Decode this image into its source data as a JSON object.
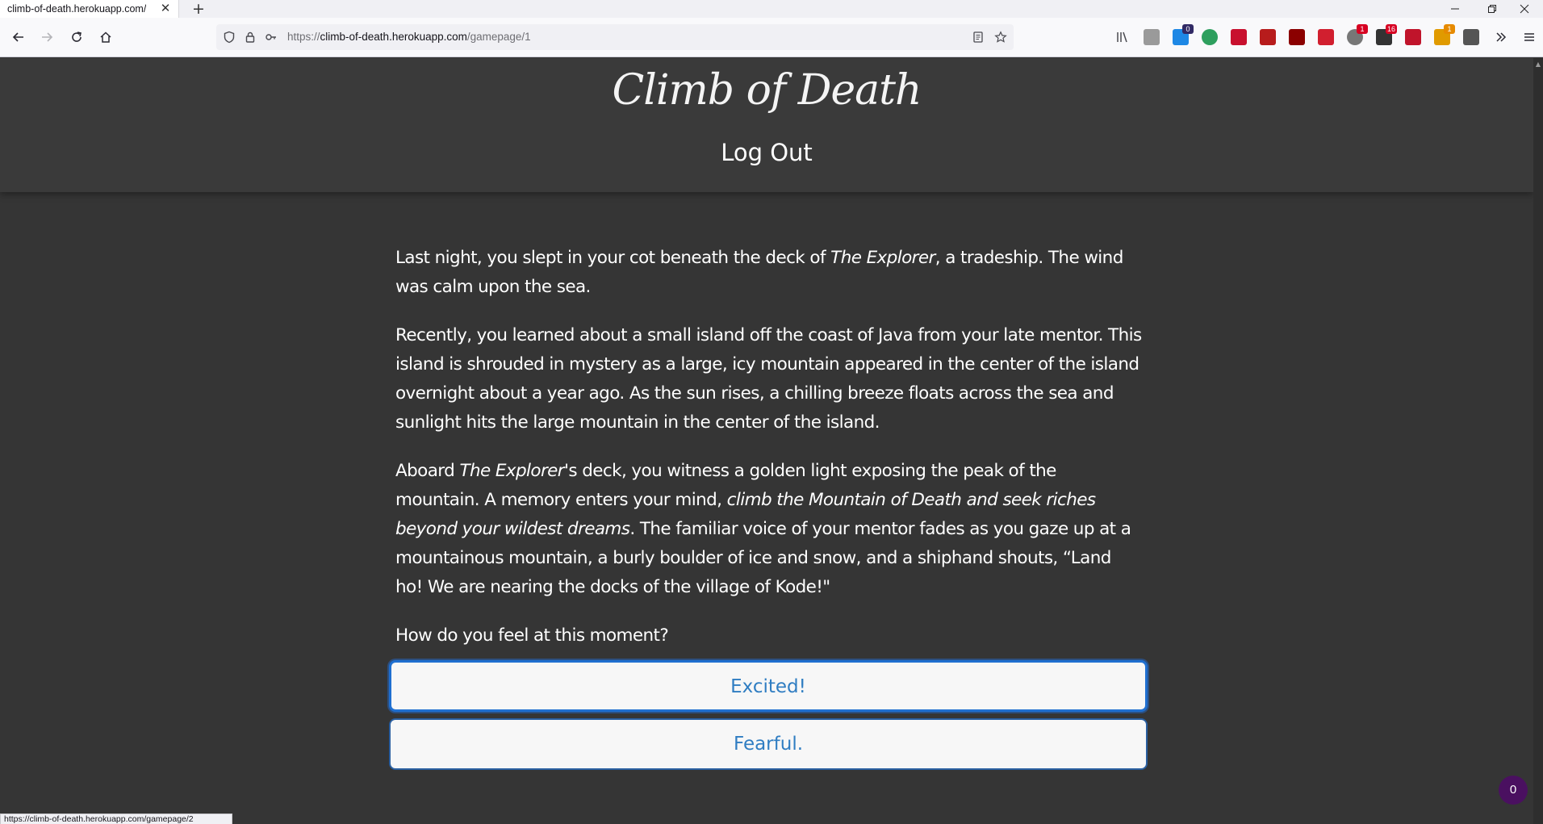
{
  "browser": {
    "tab_title": "climb-of-death.herokuapp.com/",
    "tab_close": "✕",
    "new_tab": "+",
    "url_prefix": "https://",
    "url_host": "climb-of-death.herokuapp.com",
    "url_path": "/gamepage/1",
    "status_link": "https://climb-of-death.herokuapp.com/gamepage/2",
    "extensions": [
      {
        "name": "library-icon",
        "color": "#4a4a50"
      },
      {
        "name": "extension-gray-icon",
        "color": "#9a9a9a"
      },
      {
        "name": "extension-blue-icon",
        "color": "#1e88e5",
        "badge": "0"
      },
      {
        "name": "extension-green-icon",
        "color": "#2e9f5e"
      },
      {
        "name": "extension-red-pen-icon",
        "color": "#c8102e"
      },
      {
        "name": "extension-hd-icon",
        "color": "#b71c1c"
      },
      {
        "name": "ublock-icon",
        "color": "#8b0000"
      },
      {
        "name": "extension-s-icon",
        "color": "#d11f2f"
      },
      {
        "name": "extension-gray-badge-icon",
        "color": "#777777",
        "badge": "1"
      },
      {
        "name": "extension-dark-icon",
        "color": "#333333",
        "badge": "16"
      },
      {
        "name": "extension-b-icon",
        "color": "#c0142b"
      },
      {
        "name": "extension-orange-icon",
        "color": "#e09a00",
        "badge": "1"
      },
      {
        "name": "bitwarden-icon",
        "color": "#555555"
      }
    ]
  },
  "site": {
    "logo_text": "Climb of Death",
    "logout_label": "Log Out"
  },
  "story": {
    "p1_a": "Last night, you slept in your cot beneath the deck of ",
    "p1_em": "The Explorer",
    "p1_b": ", a tradeship. The wind was calm upon the sea.",
    "p2": "Recently, you learned about a small island off the coast of Java from your late mentor. This island is shrouded in mystery as a large, icy mountain appeared in the center of the island overnight about a year ago. As the sun rises, a chilling breeze floats across the sea and sunlight hits the large mountain in the center of the island.",
    "p3_a": "Aboard ",
    "p3_em1": "The Explorer",
    "p3_b": "'s deck, you witness a golden light exposing the peak of the mountain. A memory enters your mind, ",
    "p3_em2": "climb the Mountain of Death and seek riches beyond your wildest dreams",
    "p3_c": ". The familiar voice of your mentor fades as you gaze up at a mountainous mountain, a burly boulder of ice and snow, and a shiphand shouts, “Land ho! We are nearing the docks of the village of Kode!\"",
    "p4": "How do you feel at this moment?"
  },
  "choices": {
    "option1": "Excited!",
    "option2": "Fearful."
  },
  "counter_badge": "0",
  "colors": {
    "page_bg": "#353535",
    "header_bg": "#3a3a3a",
    "button_text": "#2f7dc2",
    "button_border": "#2a5fa0"
  }
}
